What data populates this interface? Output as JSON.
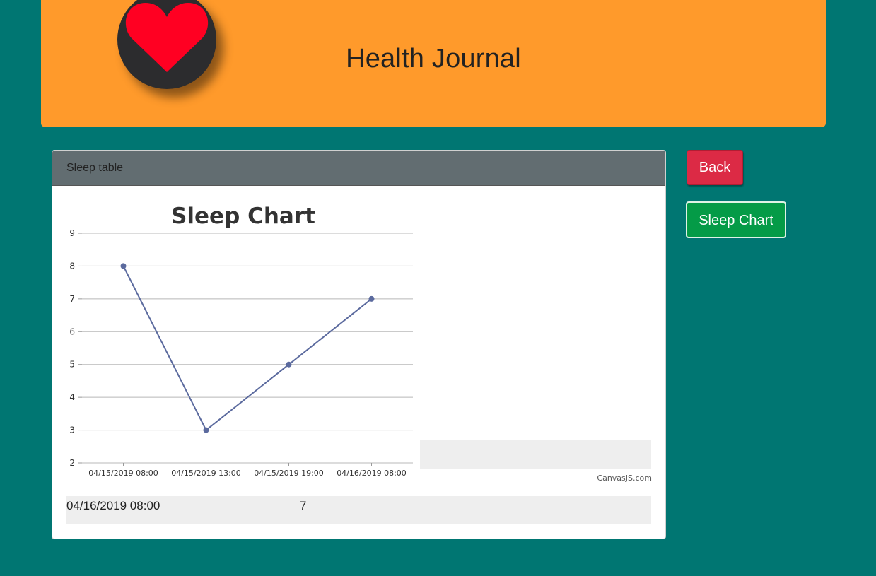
{
  "header": {
    "title": "Health Journal",
    "logo_icon": "heart-icon",
    "logo_color": "#ff0022"
  },
  "card": {
    "header_label": "Sleep table"
  },
  "chart_data": {
    "type": "line",
    "title": "Sleep Chart",
    "categories": [
      "04/15/2019 08:00",
      "04/15/2019 13:00",
      "04/15/2019 19:00",
      "04/16/2019 08:00"
    ],
    "series": [
      {
        "values": [
          8,
          3,
          5,
          7
        ],
        "color": "#5b6a9e"
      }
    ],
    "ylim": [
      2,
      9
    ],
    "yticks": [
      2,
      3,
      4,
      5,
      6,
      7,
      8,
      9
    ],
    "grid": true,
    "credit": "CanvasJS.com"
  },
  "table_row": {
    "time": "04/16/2019 08:00",
    "value": "7"
  },
  "buttons": {
    "back": "Back",
    "sleep_chart": "Sleep Chart"
  }
}
